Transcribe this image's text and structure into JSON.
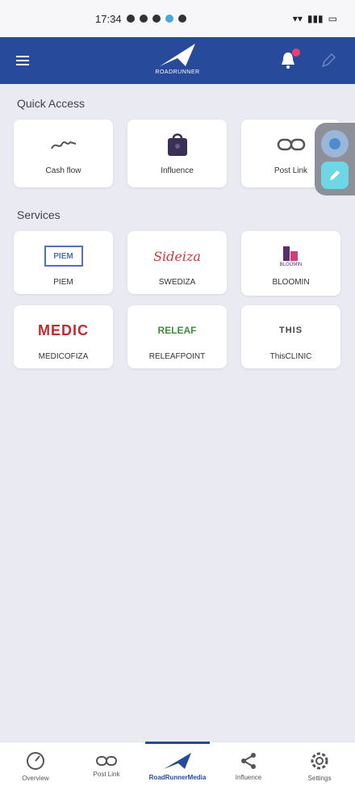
{
  "status_bar": {
    "time": "17:34"
  },
  "app_bar": {
    "logo_text": "ROADRUNNER"
  },
  "quick_access": {
    "title": "Quick Access",
    "items": [
      {
        "label": "Cash flow",
        "icon": "cash-flow-icon"
      },
      {
        "label": "Influence",
        "icon": "influence-bag-icon"
      },
      {
        "label": "Post Link",
        "icon": "link-icon"
      }
    ]
  },
  "services": {
    "title": "Services",
    "items": [
      {
        "label": "PIEM",
        "logo_text": "PIEM"
      },
      {
        "label": "SWEDIZA",
        "logo_text": "Sideiza"
      },
      {
        "label": "BLOOMIN",
        "logo_text": "BLOOMIN"
      },
      {
        "label": "MEDICOFIZA",
        "logo_text": "MEDIC"
      },
      {
        "label": "RELEAFPOINT",
        "logo_text": "RELEAF"
      },
      {
        "label": "ThisCLINIC",
        "logo_text": "THIS"
      }
    ]
  },
  "bottom_nav": {
    "items": [
      {
        "label": "Overview",
        "icon": "dashboard-icon"
      },
      {
        "label": "Post Link",
        "icon": "link-icon"
      },
      {
        "label": "RoadRunnerMedia",
        "icon": "roadrunner-logo-icon"
      },
      {
        "label": "Influence",
        "icon": "share-icon"
      },
      {
        "label": "Settings",
        "icon": "gear-icon"
      }
    ],
    "active_index": 2
  },
  "colors": {
    "brand": "#274a9a",
    "accent_cyan": "#6fd6e6",
    "badge": "#e84070"
  }
}
